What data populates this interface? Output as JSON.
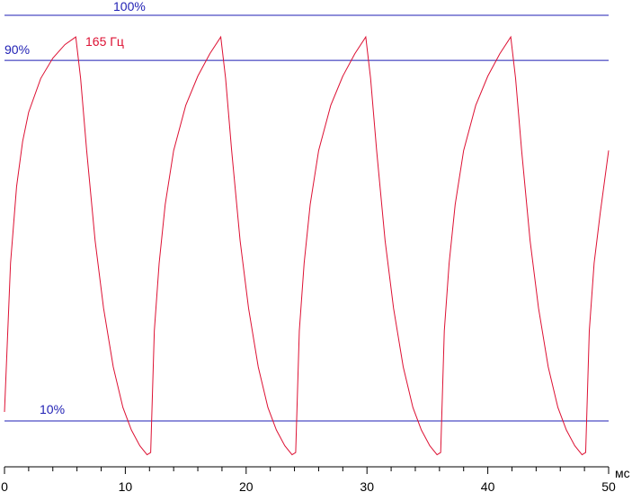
{
  "chart_data": {
    "type": "line",
    "title": "",
    "xlabel": "мс",
    "ylabel": "",
    "xlim": [
      0,
      50
    ],
    "ylim": [
      -5,
      105
    ],
    "x_ticks": [
      0,
      10,
      20,
      30,
      40,
      50
    ],
    "x_tick_labels": [
      "0",
      "10",
      "20",
      "30",
      "40",
      "50"
    ],
    "grid": false,
    "legend": "none",
    "reference_lines": [
      {
        "label": "100%",
        "y": 100,
        "color": "#1f1fb4"
      },
      {
        "label": "90%",
        "y": 90,
        "color": "#1f1fb4"
      },
      {
        "label": "10%",
        "y": 10,
        "color": "#1f1fb4"
      }
    ],
    "series": [
      {
        "name": "165 Гц",
        "color": "#dd1133",
        "points": [
          [
            0,
            12
          ],
          [
            0.5,
            45
          ],
          [
            1,
            62
          ],
          [
            1.5,
            72
          ],
          [
            2,
            78.5
          ],
          [
            3,
            86
          ],
          [
            4,
            90.5
          ],
          [
            5,
            93.5
          ],
          [
            5.9,
            95.2
          ],
          [
            6.3,
            86
          ],
          [
            6.8,
            70
          ],
          [
            7.5,
            50
          ],
          [
            8.2,
            35
          ],
          [
            9,
            22
          ],
          [
            9.8,
            13
          ],
          [
            10.5,
            8
          ],
          [
            11.2,
            4.5
          ],
          [
            11.8,
            2.5
          ],
          [
            12.1,
            3
          ],
          [
            12.4,
            30
          ],
          [
            12.8,
            45
          ],
          [
            13.3,
            58
          ],
          [
            14,
            70
          ],
          [
            15,
            80
          ],
          [
            16,
            86.5
          ],
          [
            17,
            91.5
          ],
          [
            17.9,
            95.2
          ],
          [
            18.3,
            86
          ],
          [
            18.8,
            70
          ],
          [
            19.5,
            50
          ],
          [
            20.2,
            35
          ],
          [
            21,
            22
          ],
          [
            21.8,
            13
          ],
          [
            22.5,
            8
          ],
          [
            23.2,
            4.5
          ],
          [
            23.8,
            2.5
          ],
          [
            24.1,
            3
          ],
          [
            24.4,
            30
          ],
          [
            24.8,
            45
          ],
          [
            25.3,
            58
          ],
          [
            26,
            70
          ],
          [
            27,
            80
          ],
          [
            28,
            86.5
          ],
          [
            29,
            91.5
          ],
          [
            29.9,
            95.2
          ],
          [
            30.3,
            86
          ],
          [
            30.8,
            70
          ],
          [
            31.5,
            50
          ],
          [
            32.2,
            35
          ],
          [
            33,
            22
          ],
          [
            33.8,
            13
          ],
          [
            34.5,
            8
          ],
          [
            35.2,
            4.5
          ],
          [
            35.8,
            2.5
          ],
          [
            36.1,
            3
          ],
          [
            36.4,
            30
          ],
          [
            36.8,
            45
          ],
          [
            37.3,
            58
          ],
          [
            38,
            70
          ],
          [
            39,
            80
          ],
          [
            40,
            86.5
          ],
          [
            41,
            91.5
          ],
          [
            41.9,
            95.2
          ],
          [
            42.3,
            86
          ],
          [
            42.8,
            70
          ],
          [
            43.5,
            50
          ],
          [
            44.2,
            35
          ],
          [
            45,
            22
          ],
          [
            45.8,
            13
          ],
          [
            46.5,
            8
          ],
          [
            47.2,
            4.5
          ],
          [
            47.8,
            2.5
          ],
          [
            48.1,
            3
          ],
          [
            48.4,
            30
          ],
          [
            48.8,
            45
          ],
          [
            49.3,
            56
          ],
          [
            50,
            70
          ]
        ]
      }
    ]
  }
}
